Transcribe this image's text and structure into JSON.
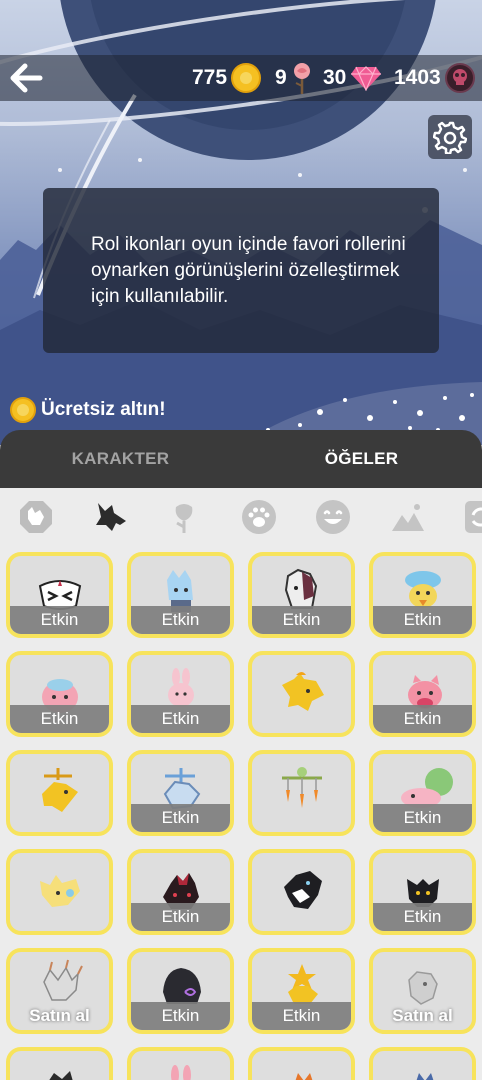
{
  "header": {
    "currencies": [
      {
        "value": "775",
        "icon": "gold-coin-icon"
      },
      {
        "value": "9",
        "icon": "rose-icon"
      },
      {
        "value": "30",
        "icon": "gem-icon"
      },
      {
        "value": "1403",
        "icon": "skull-token-icon"
      }
    ]
  },
  "info": {
    "text": "Rol ikonları oyun içinde favori rollerini oynarken görünüşlerini özelleştirmek için kullanılabilir."
  },
  "free_gold": {
    "label": "Ücretsiz altın!"
  },
  "tabs": [
    {
      "label": "KARAKTER",
      "active": false
    },
    {
      "label": "ÖĞELER",
      "active": true
    }
  ],
  "categories": [
    "wolf-emblem-icon",
    "wolf-head-icon",
    "rose-category-icon",
    "paw-icon",
    "emoji-icon",
    "landscape-icon",
    "refresh-icon"
  ],
  "grid": {
    "rows": [
      [
        {
          "status": "Etkin",
          "icon": "tribal-mask-icon"
        },
        {
          "status": "Etkin",
          "icon": "blue-wolf-icon"
        },
        {
          "status": "Etkin",
          "icon": "grey-wolf-icon"
        },
        {
          "status": "Etkin",
          "icon": "hat-duck-icon"
        }
      ],
      [
        {
          "status": "Etkin",
          "icon": "pink-bunny-icon"
        },
        {
          "status": "Etkin",
          "icon": "pink-bunny-small-icon"
        },
        {
          "status": "",
          "icon": "golden-fox-icon"
        },
        {
          "status": "Etkin",
          "icon": "pink-pig-icon"
        }
      ],
      [
        {
          "status": "",
          "icon": "gold-wolf-icon"
        },
        {
          "status": "Etkin",
          "icon": "blue-wolf-cross-icon"
        },
        {
          "status": "",
          "icon": "carrot-mobile-icon"
        },
        {
          "status": "Etkin",
          "icon": "pink-turtle-icon"
        }
      ],
      [
        {
          "status": "",
          "icon": "yellow-fox-icon"
        },
        {
          "status": "Etkin",
          "icon": "red-black-wolf-icon"
        },
        {
          "status": "",
          "icon": "black-white-wolf-icon"
        },
        {
          "status": "Etkin",
          "icon": "black-fox-icon"
        }
      ],
      [
        {
          "status": "Satın al",
          "icon": "feather-wolf-icon"
        },
        {
          "status": "Etkin",
          "icon": "hood-icon"
        },
        {
          "status": "Etkin",
          "icon": "star-fox-icon"
        },
        {
          "status": "Satın al",
          "icon": "grey-fox-icon"
        }
      ],
      [
        {
          "status": "",
          "icon": "dark-wolf-icon"
        },
        {
          "status": "",
          "icon": "pink-bunny-icon"
        },
        {
          "status": "",
          "icon": "orange-fox-icon"
        },
        {
          "status": "",
          "icon": "blue-fox-icon"
        }
      ]
    ]
  },
  "colors": {
    "card_border": "#f7e35c",
    "tab_bar": "#3a3a3a",
    "gold": "#f5c022",
    "gem": "#f05c94"
  }
}
